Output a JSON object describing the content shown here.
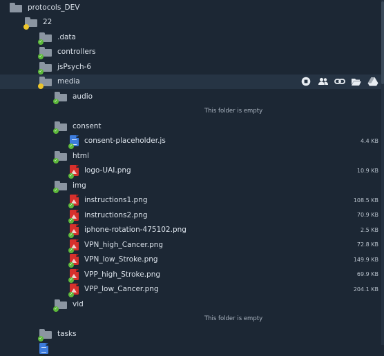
{
  "colors": {
    "background": "#1c2734",
    "selected_row": "#263444",
    "folder": "#8b95a1",
    "image_file": "#d6302c",
    "js_file": "#3d7cdc",
    "status_ok": "#5cb83a",
    "status_pending": "#ecc52a"
  },
  "tree": {
    "protocols_dev": {
      "label": "protocols_DEV"
    },
    "f22": {
      "label": "22"
    },
    "data": {
      "label": ".data"
    },
    "controllers": {
      "label": "controllers"
    },
    "jspsych": {
      "label": "jsPsych-6"
    },
    "media": {
      "label": "media"
    },
    "audio": {
      "label": "audio",
      "empty_text": "This folder is empty"
    },
    "consent": {
      "label": "consent"
    },
    "consent_file": {
      "label": "consent-placeholder.js",
      "size": "4.4 KB"
    },
    "html": {
      "label": "html"
    },
    "logo": {
      "label": "logo-UAI.png",
      "size": "10.9 KB"
    },
    "img": {
      "label": "img"
    },
    "img_files": [
      {
        "label": "instructions1.png",
        "size": "108.5 KB"
      },
      {
        "label": "instructions2.png",
        "size": "70.9 KB"
      },
      {
        "label": "iphone-rotation-475102.png",
        "size": "2.5 KB"
      },
      {
        "label": "VPN_high_Cancer.png",
        "size": "72.8 KB"
      },
      {
        "label": "VPN_low_Stroke.png",
        "size": "149.9 KB"
      },
      {
        "label": "VPP_high_Stroke.png",
        "size": "69.9 KB"
      },
      {
        "label": "VPP_low_Cancer.png",
        "size": "204.1 KB"
      }
    ],
    "vid": {
      "label": "vid",
      "empty_text": "This folder is empty"
    },
    "tasks": {
      "label": "tasks"
    }
  },
  "row_actions": {
    "icons": [
      "stop-icon",
      "share-users-icon",
      "link-icon",
      "open-folder-icon",
      "drive-icon"
    ]
  }
}
